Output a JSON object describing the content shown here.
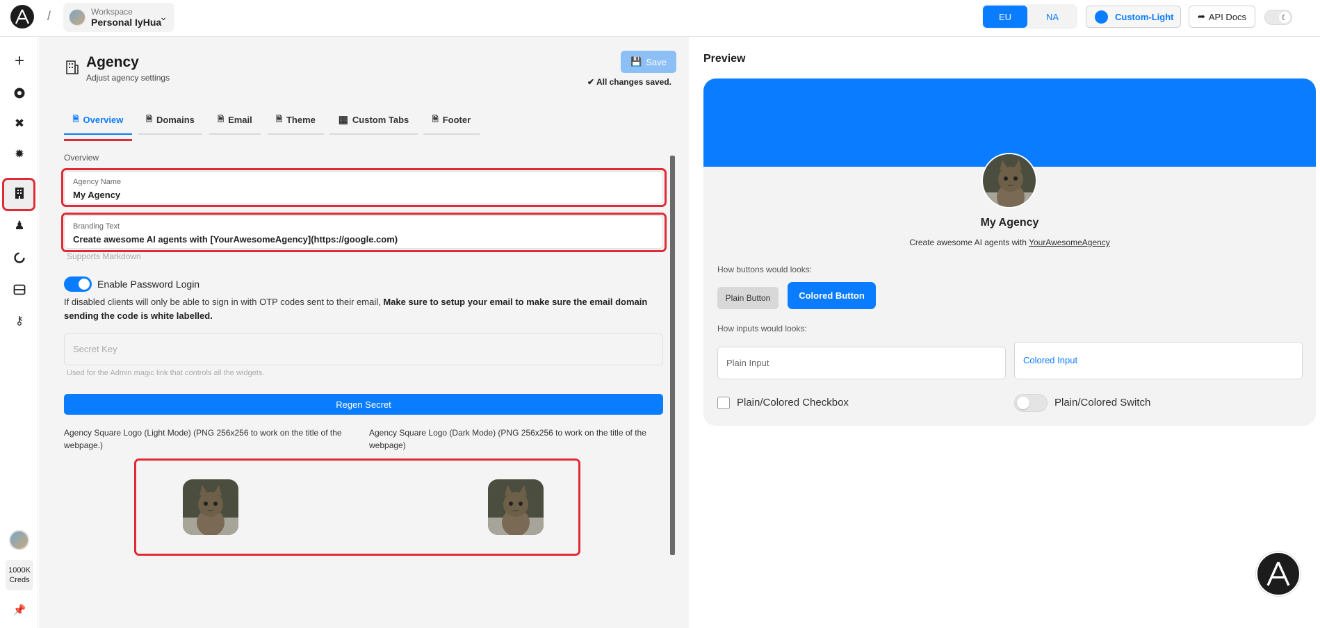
{
  "topbar": {
    "workspace_label": "Workspace",
    "workspace_name": "Personal IyHua",
    "region_eu": "EU",
    "region_na": "NA",
    "theme_label": "Custom-Light",
    "api_docs_label": "API Docs",
    "separator": "/"
  },
  "sidebar": {
    "icons": [
      "plus-icon",
      "openai-icon",
      "tools-icon",
      "bug-icon",
      "building-icon",
      "users-icon",
      "loader-icon",
      "server-icon",
      "key-icon"
    ],
    "creds_value": "1000K",
    "creds_label": "Creds"
  },
  "page": {
    "title": "Agency",
    "subtitle": "Adjust agency settings",
    "save_label": "Save",
    "saved_status": "All changes saved."
  },
  "tabs": [
    {
      "label": "Overview",
      "icon": "file-icon"
    },
    {
      "label": "Domains",
      "icon": "file-icon"
    },
    {
      "label": "Email",
      "icon": "file-icon"
    },
    {
      "label": "Theme",
      "icon": "file-icon"
    },
    {
      "label": "Custom Tabs",
      "icon": "grid-icon"
    },
    {
      "label": "Footer",
      "icon": "file-icon"
    }
  ],
  "overview": {
    "section_label": "Overview",
    "agency_name_label": "Agency Name",
    "agency_name_value": "My Agency",
    "branding_label": "Branding Text",
    "branding_value": "Create awesome AI agents with [YourAwesomeAgency](https://google.com)",
    "branding_hint": "Supports Markdown",
    "password_login_label": "Enable Password Login",
    "password_note_normal": "If disabled clients will only be able to sign in with OTP codes sent to their email, ",
    "password_note_bold": "Make sure to setup your email to make sure the email domain sending the code is white labelled.",
    "secret_placeholder": "Secret Key",
    "secret_hint": "Used for the Admin magic link that controls all the widgets.",
    "regen_label": "Regen Secret",
    "logo_light_label": "Agency Square Logo (Light Mode) (PNG 256x256 to work on the title of the webpage.)",
    "logo_dark_label": "Agency Square Logo (Dark Mode) (PNG 256x256 to work on the title of the webpage)"
  },
  "preview": {
    "title": "Preview",
    "agency_name": "My Agency",
    "brand_prefix": "Create awesome AI agents with ",
    "brand_link": "YourAwesomeAgency",
    "buttons_label": "How buttons would looks:",
    "plain_button": "Plain Button",
    "colored_button": "Colored Button",
    "inputs_label": "How inputs would looks:",
    "plain_input": "Plain Input",
    "colored_input": "Colored Input",
    "checkbox_label": "Plain/Colored Checkbox",
    "switch_label": "Plain/Colored Switch"
  },
  "colors": {
    "accent": "#0a7cff",
    "highlight": "#e02b37"
  }
}
